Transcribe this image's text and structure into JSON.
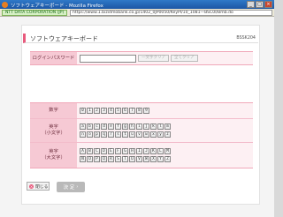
{
  "window": {
    "title": "ソフトウェアキーボード - Mozilla Firefox",
    "site_identity": "NTT DATA CORPORATION (JP)",
    "url": "https://www.1.bizidmobank.co.jp/1402_0JP0050/KeyPl/10_1081—BSC0I/Bmb.do"
  },
  "page": {
    "title": "ソフトウェアキーボード",
    "code": "BSSK204"
  },
  "login": {
    "label": "ログインパスワード",
    "clear_one_label": "一文字クリア",
    "clear_all_label": "全てクリア"
  },
  "keyboard": {
    "numbers": {
      "label": "数字",
      "rows": [
        [
          "0",
          "1",
          "2",
          "3",
          "4",
          "5",
          "6",
          "7",
          "8",
          "9"
        ]
      ]
    },
    "lowercase": {
      "label": "英字\n（小文字）",
      "rows": [
        [
          "a",
          "b",
          "c",
          "d",
          "e",
          "f",
          "g",
          "h",
          "i",
          "j",
          "k",
          "l",
          "m"
        ],
        [
          "n",
          "o",
          "p",
          "q",
          "r",
          "s",
          "t",
          "u",
          "v",
          "w",
          "x",
          "y",
          "z"
        ]
      ]
    },
    "uppercase": {
      "label": "英字\n（大文字）",
      "rows": [
        [
          "A",
          "B",
          "C",
          "D",
          "E",
          "F",
          "G",
          "H",
          "I",
          "J",
          "K",
          "L",
          "M"
        ],
        [
          "N",
          "O",
          "P",
          "Q",
          "R",
          "S",
          "T",
          "U",
          "V",
          "W",
          "X",
          "Y",
          "Z"
        ]
      ]
    }
  },
  "footer": {
    "close_label": "閉じる",
    "ok_label": "決 定"
  },
  "icons": {
    "close": "close-circle-icon",
    "ok": "chevron-right-icon"
  },
  "colors": {
    "accent_pink": "#e85a7d",
    "label_bg": "#f6c9d4",
    "row_bg": "#fdf0f3"
  }
}
